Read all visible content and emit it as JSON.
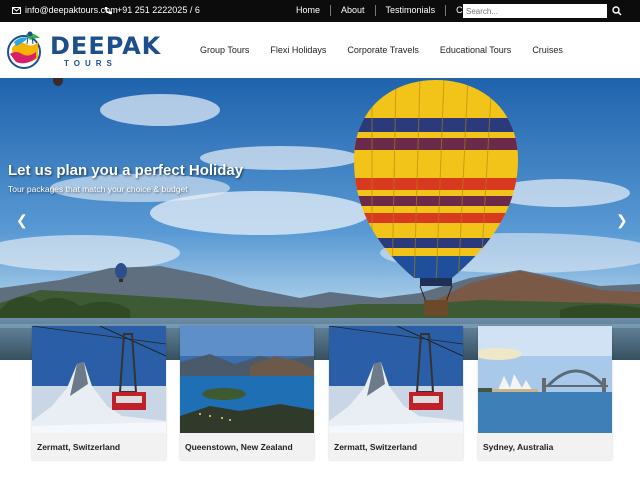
{
  "topbar": {
    "email": "info@deepaktours.com",
    "phone": "+91 251 2222025 / 6",
    "nav": [
      "Home",
      "About",
      "Testimonials",
      "Contact"
    ],
    "search_placeholder": "Search..."
  },
  "brand": {
    "name": "DEEPAK",
    "sub": "TOURS"
  },
  "mainnav": [
    "Group Tours",
    "Flexi Holidays",
    "Corporate Travels",
    "Educational Tours",
    "Cruises"
  ],
  "hero": {
    "title": "Let us plan you a perfect Holiday",
    "subtitle": "Tour packages that match your choice & budget"
  },
  "cards": [
    {
      "caption": "Zermatt, Switzerland"
    },
    {
      "caption": "Queenstown, New Zealand"
    },
    {
      "caption": "Zermatt, Switzerland"
    },
    {
      "caption": "Sydney, Australia"
    }
  ],
  "colors": {
    "topbar_bg": "#0c0c0c",
    "brand_blue": "#1d4f8c"
  }
}
